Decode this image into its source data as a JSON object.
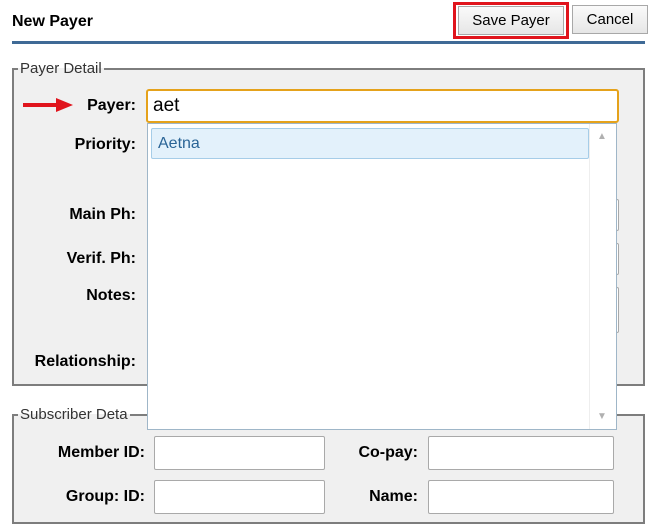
{
  "header": {
    "title": "New Payer",
    "save_label": "Save Payer",
    "cancel_label": "Cancel"
  },
  "payer_detail": {
    "legend": "Payer Detail",
    "payer_label": "Payer:",
    "payer_value": "aet",
    "priority_label": "Priority:",
    "main_ph_label": "Main Ph:",
    "verif_ph_label": "Verif. Ph:",
    "notes_label": "Notes:",
    "relationship_label": "Relationship:"
  },
  "autocomplete": {
    "items": [
      "Aetna"
    ]
  },
  "subscriber_detail": {
    "legend": "Subscriber Deta",
    "member_id_label": "Member ID:",
    "copay_label": "Co-pay:",
    "group_id_label": "Group: ID:",
    "name_label": "Name:"
  },
  "colors": {
    "header_rule": "#3f6a96",
    "highlight_red": "#e0141c",
    "focus_orange": "#e5a21b",
    "dropdown_item_bg": "#e3f1fb",
    "dropdown_item_text": "#2a6496"
  },
  "icons": {
    "annotation_arrow": "red-right-arrow-icon",
    "scroll_up": "triangle-up-icon",
    "scroll_down": "triangle-down-icon"
  }
}
